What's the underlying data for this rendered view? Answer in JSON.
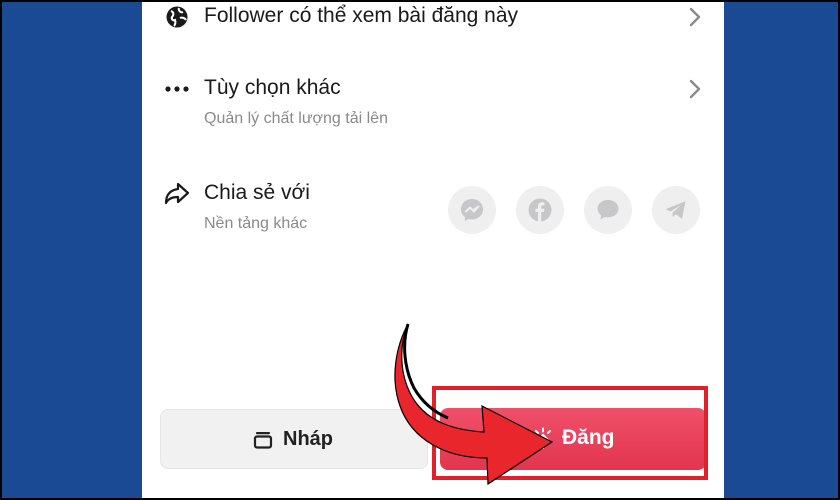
{
  "rows": {
    "follower": {
      "title": "Follower có thể xem bài đăng này",
      "icon": "globe-icon"
    },
    "more_options": {
      "title": "Tùy chọn khác",
      "subtitle": "Quản lý chất lượng tải lên",
      "icon": "more-dots-icon"
    },
    "share": {
      "title": "Chia sẻ với",
      "subtitle": "Nền tảng khác",
      "icon": "share-icon"
    }
  },
  "share_targets": [
    {
      "name": "messenger",
      "icon": "messenger-icon"
    },
    {
      "name": "facebook",
      "icon": "facebook-icon"
    },
    {
      "name": "message",
      "icon": "chat-bubble-icon"
    },
    {
      "name": "telegram",
      "icon": "telegram-icon"
    }
  ],
  "buttons": {
    "draft_label": "Nháp",
    "post_label": "Đăng"
  },
  "colors": {
    "side_panel": "#1b4a94",
    "post_button": "#e83e58",
    "highlight": "#e0212a",
    "arrow": "#e8262c"
  }
}
